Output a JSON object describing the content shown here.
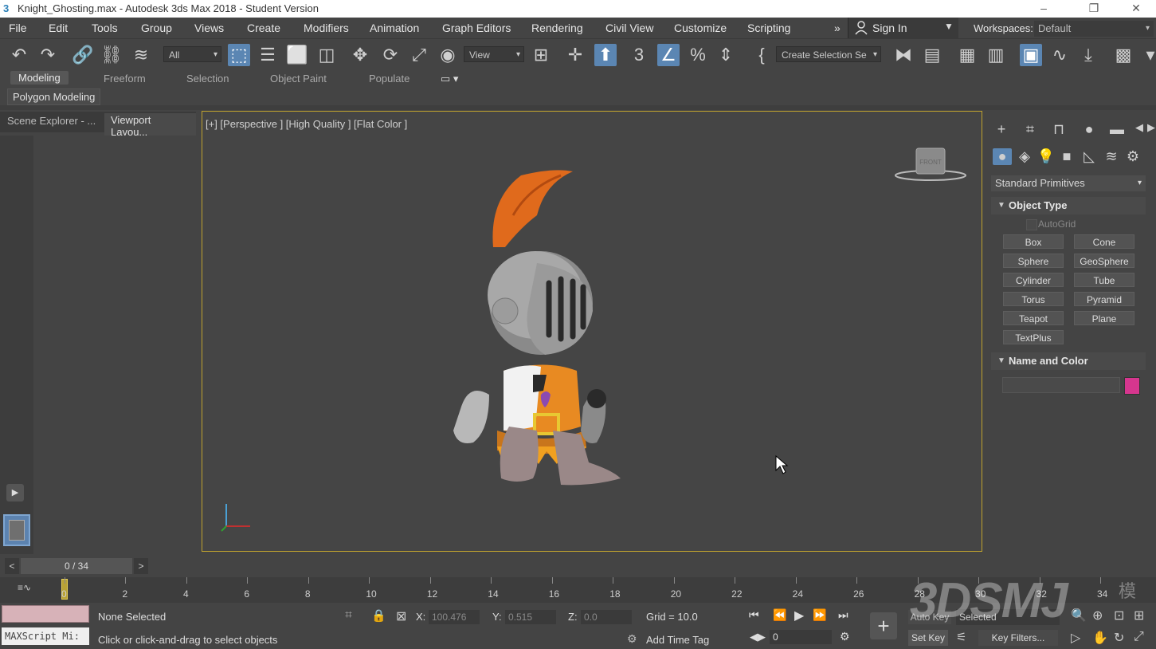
{
  "window": {
    "title": "Knight_Ghosting.max - Autodesk 3ds Max 2018 - Student Version",
    "app_icon": "3",
    "minimize": "–",
    "maximize": "❐",
    "close": "✕"
  },
  "menubar": {
    "items": [
      "File",
      "Edit",
      "Tools",
      "Group",
      "Views",
      "Create",
      "Modifiers",
      "Animation",
      "Graph Editors",
      "Rendering",
      "Civil View",
      "Customize",
      "Scripting"
    ],
    "overflow": "»",
    "sign_in": "Sign In",
    "workspaces_label": "Workspaces:",
    "workspace_value": "Default"
  },
  "toolbar": {
    "filter_dropdown": "All",
    "ref_coord_dropdown": "View",
    "named_selection": "Create Selection Se"
  },
  "ribbon": {
    "tabs": [
      "Modeling",
      "Freeform",
      "Selection",
      "Object Paint",
      "Populate"
    ],
    "active_tab": "Modeling",
    "subtab": "Polygon Modeling"
  },
  "left_panel": {
    "tabs": [
      "Scene Explorer - ...",
      "Viewport Layou..."
    ]
  },
  "viewport": {
    "label": "[+] [Perspective ] [High Quality ] [Flat Color ]",
    "viewcube_label": "FRONT"
  },
  "command_panel": {
    "category_dropdown": "Standard Primitives",
    "object_type": {
      "title": "Object Type",
      "autogrid_label": "AutoGrid",
      "buttons": [
        "Box",
        "Cone",
        "Sphere",
        "GeoSphere",
        "Cylinder",
        "Tube",
        "Torus",
        "Pyramid",
        "Teapot",
        "Plane",
        "TextPlus"
      ]
    },
    "name_and_color": {
      "title": "Name and Color",
      "name_value": "",
      "swatch_color": "#d6368e"
    }
  },
  "timeline": {
    "frame_display": "0 / 34",
    "prev": "<",
    "next": ">",
    "ticks": [
      "0",
      "2",
      "4",
      "6",
      "8",
      "10",
      "12",
      "14",
      "16",
      "18",
      "20",
      "22",
      "24",
      "26",
      "28",
      "30",
      "32",
      "34"
    ]
  },
  "status": {
    "selection": "None Selected",
    "prompt": "Click or click-and-drag to select objects",
    "maxscript": "MAXScript Mi:",
    "x_label": "X:",
    "x_value": "100.476",
    "y_label": "Y:",
    "y_value": "0.515",
    "z_label": "Z:",
    "z_value": "0.0",
    "grid": "Grid = 10.0",
    "add_time_tag": "Add Time Tag",
    "auto_key": "Auto Key",
    "selected_dropdown": "Selected",
    "set_key": "Set Key",
    "key_filters": "Key Filters...",
    "current_frame": "0"
  },
  "watermark": "3DSMJ",
  "watermark_cjk": "模"
}
